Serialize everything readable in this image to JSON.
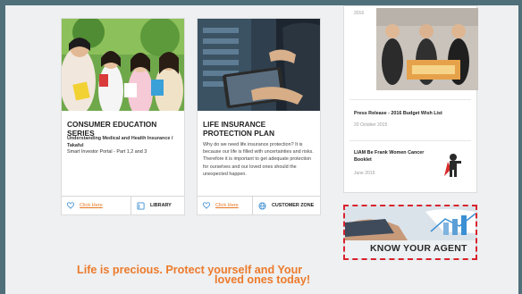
{
  "cards": [
    {
      "title": "CONSUMER EDUCATION SERIES",
      "subtitle_bold": "Understanding Medical and Health Insurance / Takaful",
      "subtitle": "Smart Investor Portal - Part 1,2 and 3",
      "link": "Click Here",
      "action": "LIBRARY",
      "action_icon": "book-icon"
    },
    {
      "title": "LIFE INSURANCE PROTECTION PLAN",
      "body": "Why do we need life insurance protection? It is because our life is filled with uncertainties and risks. Therefore it is important to get adequate protection for ourselves and our loved ones should the unexpected happen.",
      "link": "Click Here",
      "action": "CUSTOMER ZONE",
      "action_icon": "globe-icon"
    }
  ],
  "sidebar": {
    "top_date": "2016",
    "news": [
      {
        "title": "Press Release - 2016 Budget Wish List",
        "date": "20 October 2015"
      },
      {
        "title": "LIAM Be Frank Women Cancer Booklet",
        "date": "June 2015"
      }
    ]
  },
  "agent_banner": {
    "text": "KNOW YOUR AGENT"
  },
  "slogan": {
    "line1": "Life is precious. Protect yourself and Your",
    "line2": "loved ones today!"
  },
  "colors": {
    "accent": "#e87722",
    "icon_blue": "#3b8fd4",
    "dash_red": "#d9232e"
  }
}
